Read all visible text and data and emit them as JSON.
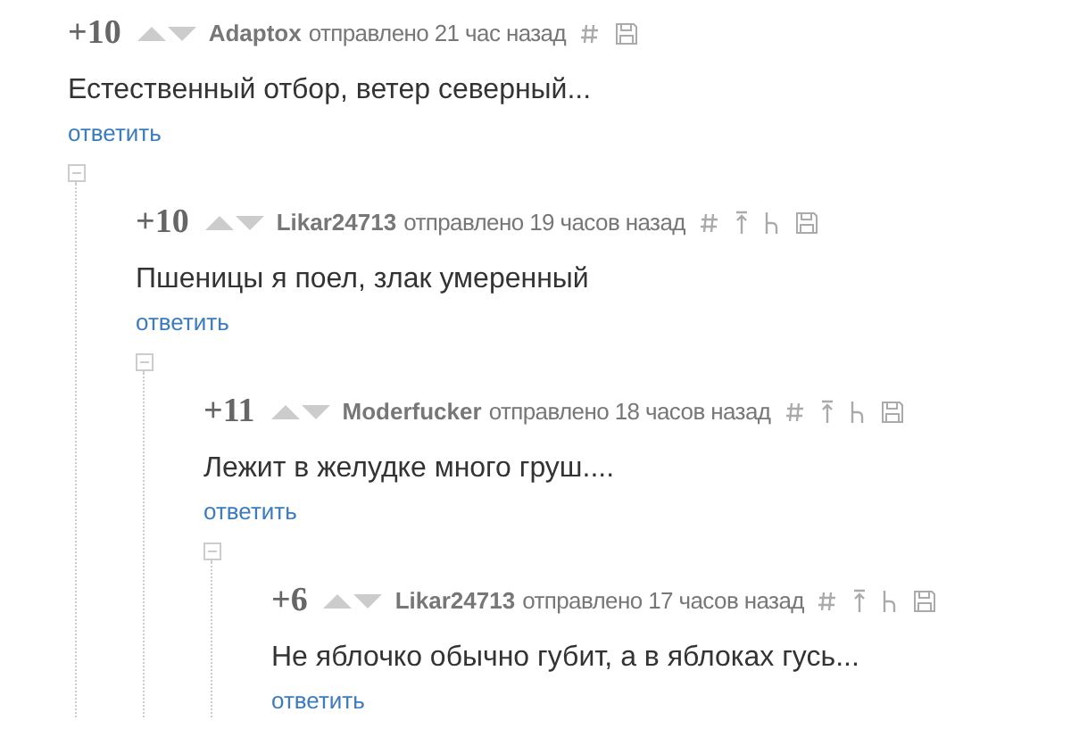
{
  "comments": [
    {
      "kind": "root",
      "score": "+10",
      "author": "Adaptox",
      "time": "отправлено 21 час назад",
      "text": "Естественный отбор, ветер северный...",
      "reply": "ответить",
      "children": [
        {
          "kind": "reply",
          "score": "+10",
          "author": "Likar24713",
          "time": "отправлено 19 часов назад",
          "text": "Пшеницы я поел, злак умеренный",
          "reply": "ответить",
          "children": [
            {
              "kind": "reply",
              "score": "+11",
              "author": "Moderfucker",
              "time": "отправлено 18 часов назад",
              "text": "Лежит в желудке много груш....",
              "reply": "ответить",
              "children": [
                {
                  "kind": "reply",
                  "score": "+6",
                  "author": "Likar24713",
                  "time": "отправлено 17 часов назад",
                  "text": "Не яблочко обычно губит, а в яблоках гусь...",
                  "reply": "ответить"
                }
              ]
            }
          ]
        }
      ]
    }
  ]
}
